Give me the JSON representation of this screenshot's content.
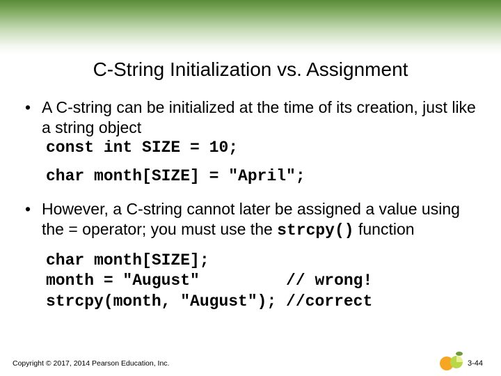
{
  "title": "C-String Initialization vs. Assignment",
  "bullets": [
    {
      "text": "A C-string can be initialized at the time of its creation, just like a string object",
      "code1": "const int SIZE = 10;",
      "code2": "char month[SIZE] = \"April\";"
    },
    {
      "text_pre": "However, a C-string cannot later be assigned a value using the = operator; you must use the ",
      "text_code": "strcpy()",
      "text_post": " function",
      "code_block": "char month[SIZE];\nmonth = \"August\"         // wrong!\nstrcpy(month, \"August\"); //correct"
    }
  ],
  "copyright": "Copyright © 2017, 2014 Pearson Education, Inc.",
  "page_number": "3-44"
}
